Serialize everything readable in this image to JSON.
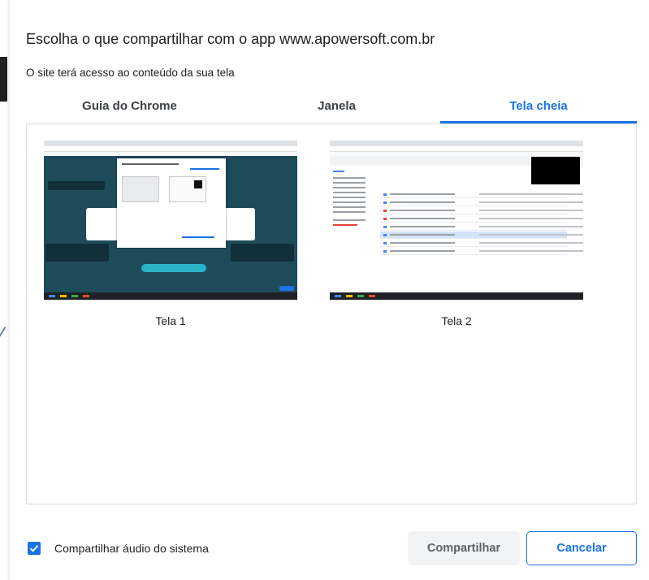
{
  "dialog": {
    "title": "Escolha o que compartilhar com o app www.apowersoft.com.br",
    "subtitle": "O site terá acesso ao conteúdo da sua tela"
  },
  "tabs": [
    {
      "label": "Guia do Chrome",
      "selected": false
    },
    {
      "label": "Janela",
      "selected": false
    },
    {
      "label": "Tela cheia",
      "selected": true
    }
  ],
  "screens": [
    {
      "label": "Tela 1"
    },
    {
      "label": "Tela 2"
    }
  ],
  "footer": {
    "audio_checkbox_checked": true,
    "audio_label": "Compartilhar áudio do sistema",
    "share_button": "Compartilhar",
    "cancel_button": "Cancelar"
  },
  "colors": {
    "accent": "#1a73e8",
    "disabled_button_bg": "#f1f3f4",
    "divider": "#dadce0"
  }
}
